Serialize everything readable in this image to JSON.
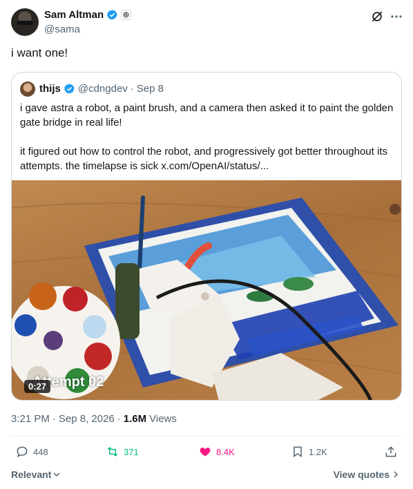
{
  "author": {
    "name": "Sam Altman",
    "handle": "@sama",
    "affiliation_badge": "OpenAI logo"
  },
  "tweet": {
    "text": "i want one!"
  },
  "quoted_tweet": {
    "name": "thijs",
    "handle": "@cdngdev",
    "separator": "·",
    "date": "Sep 8",
    "paragraphs": [
      "i gave astra a robot, a paint brush, and a camera then asked it to paint the golden gate bridge in real life!",
      "it figured out how to control the robot, and progressively got better throughout its attempts. the timelapse is sick  x.com/OpenAI/status/..."
    ],
    "media": {
      "duration": "0:27",
      "overlay_text": "Attempt 02"
    }
  },
  "meta": {
    "time": "3:21 PM",
    "separator": "·",
    "date": "Sep 8, 2026",
    "separator2": "·",
    "views_count": "1.6M",
    "views_label": "Views"
  },
  "actions": {
    "replies": "448",
    "retweets": "371",
    "likes": "8.4K",
    "bookmarks": "1.2K"
  },
  "footer": {
    "sort_label": "Relevant",
    "view_quotes": "View quotes"
  },
  "colors": {
    "verified": "#1d9bf0",
    "retweet": "#00ba7c",
    "like": "#f91880",
    "muted": "#536471"
  },
  "icons": [
    "verified-badge-icon",
    "grok-icon",
    "more-icon",
    "reply-icon",
    "retweet-icon",
    "heart-icon",
    "bookmark-icon",
    "share-icon",
    "chevron-down-icon",
    "chevron-right-icon"
  ]
}
